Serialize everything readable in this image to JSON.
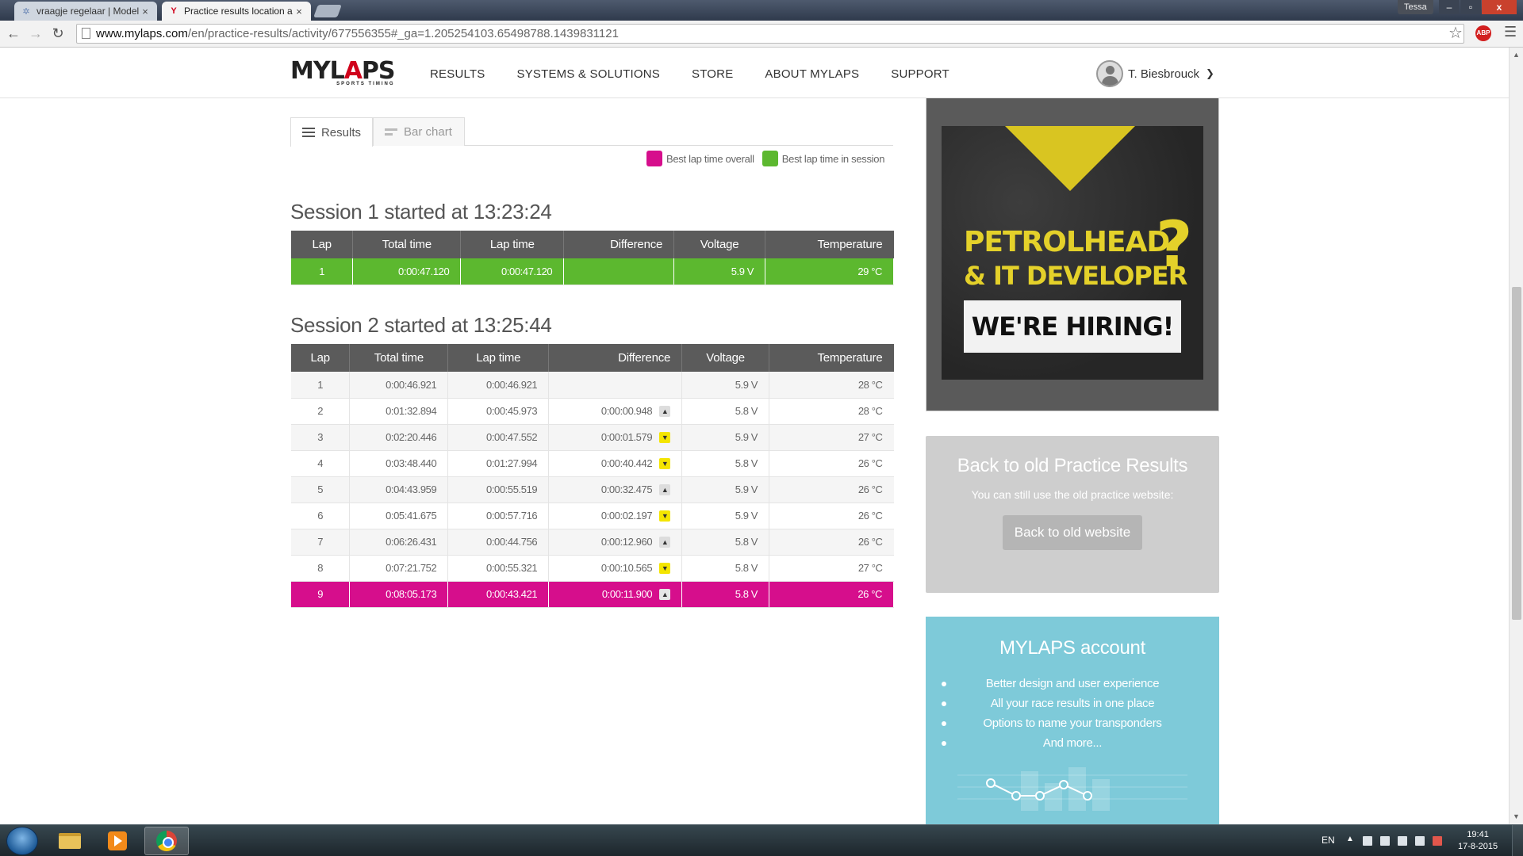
{
  "browser": {
    "tabs": [
      {
        "label": "vraagje regelaar | Modelb",
        "close": "×"
      },
      {
        "label": "Practice results location a",
        "close": "×"
      }
    ],
    "profile": "Tessa",
    "window_controls": {
      "min": "–",
      "max": "▫",
      "close": "x"
    },
    "url_host": "www.mylaps.com",
    "url_path": "/en/practice-results/activity/677556355#_ga=1.205254103.65498788.1439831121",
    "abp_label": "ABP"
  },
  "site": {
    "logo": "MYLAPS",
    "logo_sub": "SPORTS TIMING",
    "nav": [
      "RESULTS",
      "SYSTEMS & SOLUTIONS",
      "STORE",
      "ABOUT MYLAPS",
      "SUPPORT"
    ],
    "user": "T. Biesbrouck"
  },
  "view_tabs": {
    "results": "Results",
    "bar_chart": "Bar chart"
  },
  "legend": {
    "overall": "Best lap time overall",
    "session": "Best lap time in session"
  },
  "colors": {
    "best_overall": "#d60e8c",
    "best_session": "#5cb82f",
    "arrow_down": "#f4e500",
    "account_bg": "#7ecad9"
  },
  "table_headers": [
    "Lap",
    "Total time",
    "Lap time",
    "Difference",
    "Voltage",
    "Temperature"
  ],
  "sessions": [
    {
      "title": "Session 1 started at 13:23:24",
      "laps": [
        {
          "lap": "1",
          "total": "0:00:47.120",
          "lap_time": "0:00:47.120",
          "diff": "",
          "arrow": "",
          "voltage": "5.9 V",
          "temp": "29 °C",
          "highlight": "session"
        }
      ]
    },
    {
      "title": "Session 2 started at 13:25:44",
      "laps": [
        {
          "lap": "1",
          "total": "0:00:46.921",
          "lap_time": "0:00:46.921",
          "diff": "",
          "arrow": "",
          "voltage": "5.9 V",
          "temp": "28 °C",
          "highlight": ""
        },
        {
          "lap": "2",
          "total": "0:01:32.894",
          "lap_time": "0:00:45.973",
          "diff": "0:00:00.948",
          "arrow": "up",
          "voltage": "5.8 V",
          "temp": "28 °C",
          "highlight": ""
        },
        {
          "lap": "3",
          "total": "0:02:20.446",
          "lap_time": "0:00:47.552",
          "diff": "0:00:01.579",
          "arrow": "down",
          "voltage": "5.9 V",
          "temp": "27 °C",
          "highlight": ""
        },
        {
          "lap": "4",
          "total": "0:03:48.440",
          "lap_time": "0:01:27.994",
          "diff": "0:00:40.442",
          "arrow": "down",
          "voltage": "5.8 V",
          "temp": "26 °C",
          "highlight": ""
        },
        {
          "lap": "5",
          "total": "0:04:43.959",
          "lap_time": "0:00:55.519",
          "diff": "0:00:32.475",
          "arrow": "up",
          "voltage": "5.9 V",
          "temp": "26 °C",
          "highlight": ""
        },
        {
          "lap": "6",
          "total": "0:05:41.675",
          "lap_time": "0:00:57.716",
          "diff": "0:00:02.197",
          "arrow": "down",
          "voltage": "5.9 V",
          "temp": "26 °C",
          "highlight": ""
        },
        {
          "lap": "7",
          "total": "0:06:26.431",
          "lap_time": "0:00:44.756",
          "diff": "0:00:12.960",
          "arrow": "up",
          "voltage": "5.8 V",
          "temp": "26 °C",
          "highlight": ""
        },
        {
          "lap": "8",
          "total": "0:07:21.752",
          "lap_time": "0:00:55.321",
          "diff": "0:00:10.565",
          "arrow": "down",
          "voltage": "5.8 V",
          "temp": "27 °C",
          "highlight": ""
        },
        {
          "lap": "9",
          "total": "0:08:05.173",
          "lap_time": "0:00:43.421",
          "diff": "0:00:11.900",
          "arrow": "up",
          "voltage": "5.8 V",
          "temp": "26 °C",
          "highlight": "overall"
        }
      ]
    }
  ],
  "ad": {
    "line1": "PETROLHEAD",
    "line2": "& IT DEVELOPER",
    "qmark": "?",
    "hiring": "WE'RE HIRING!"
  },
  "old_results": {
    "title": "Back to old Practice Results",
    "text": "You can still use the old practice website:",
    "button": "Back to old website"
  },
  "account": {
    "title": "MYLAPS account",
    "items": [
      "Better design and user experience",
      "All your race results in one place",
      "Options to name your transponders",
      "And more..."
    ]
  },
  "taskbar": {
    "lang": "EN",
    "time": "19:41",
    "date": "17-8-2015"
  }
}
